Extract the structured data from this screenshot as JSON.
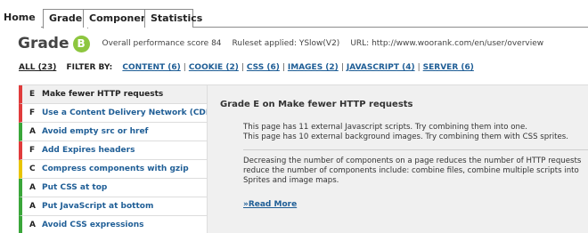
{
  "tabs": [
    {
      "label": "Home"
    },
    {
      "label": "Grade"
    },
    {
      "label": "Components"
    },
    {
      "label": "Statistics"
    }
  ],
  "header": {
    "grade_word": "Grade",
    "grade_letter": "B",
    "score_text": "Overall performance score 84",
    "ruleset_text": "Ruleset applied: YSlow(V2)",
    "url_text": "URL: http://www.woorank.com/en/user/overview"
  },
  "filters": {
    "all": "ALL (23)",
    "label": "FILTER BY:",
    "items": [
      "CONTENT (6)",
      "COOKIE (2)",
      "CSS (6)",
      "IMAGES (2)",
      "JAVASCRIPT (4)",
      "SERVER (6)"
    ],
    "separator": "|"
  },
  "rules": [
    {
      "grade": "E",
      "label": "Make fewer HTTP requests"
    },
    {
      "grade": "F",
      "label": "Use a Content Delivery Network (CDN)"
    },
    {
      "grade": "A",
      "label": "Avoid empty src or href"
    },
    {
      "grade": "F",
      "label": "Add Expires headers"
    },
    {
      "grade": "C",
      "label": "Compress components with gzip"
    },
    {
      "grade": "A",
      "label": "Put CSS at top"
    },
    {
      "grade": "A",
      "label": "Put JavaScript at bottom"
    },
    {
      "grade": "A",
      "label": "Avoid CSS expressions"
    }
  ],
  "detail": {
    "title": "Grade E on Make fewer HTTP requests",
    "line1": "This page has 11 external Javascript scripts. Try combining them into one.",
    "line2": "This page has 10 external background images. Try combining them with CSS sprites.",
    "para_l1": "Decreasing the number of components on a page reduces the number of HTTP requests",
    "para_l2": "reduce the number of components include: combine files, combine multiple scripts into",
    "para_l3": "Sprites and image maps.",
    "read_more": "»Read More"
  },
  "colors": {
    "grade_badge": "#8dc63f",
    "link": "#1f5e96",
    "grade_F": "#e03c3c",
    "grade_E": "#e03c3c",
    "grade_A": "#3aa63a",
    "grade_C": "#e8c400"
  }
}
